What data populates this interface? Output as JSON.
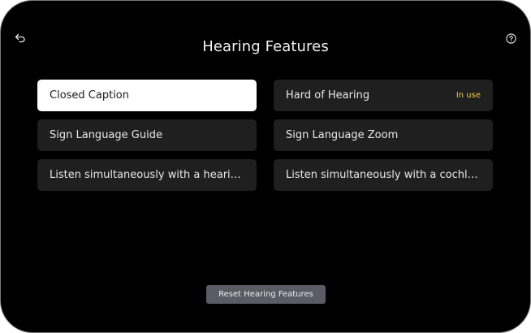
{
  "header": {
    "title": "Hearing Features",
    "back_icon": "back-arrow-icon",
    "help_icon": "help-circle-icon"
  },
  "options": [
    {
      "label": "Closed Caption",
      "selected": true,
      "badge": ""
    },
    {
      "label": "Hard of Hearing",
      "selected": false,
      "badge": "In use"
    },
    {
      "label": "Sign Language Guide",
      "selected": false,
      "badge": ""
    },
    {
      "label": "Sign Language Zoom",
      "selected": false,
      "badge": ""
    },
    {
      "label": "Listen simultaneously with a hearing a...",
      "selected": false,
      "badge": ""
    },
    {
      "label": "Listen simultaneously with a cochlear...",
      "selected": false,
      "badge": ""
    }
  ],
  "footer": {
    "reset_label": "Reset Hearing Features"
  },
  "colors": {
    "background": "#000000",
    "option_bg": "#1f1f1f",
    "option_selected_bg": "#ffffff",
    "badge": "#f0c84a",
    "reset_bg": "#5b5b66"
  }
}
